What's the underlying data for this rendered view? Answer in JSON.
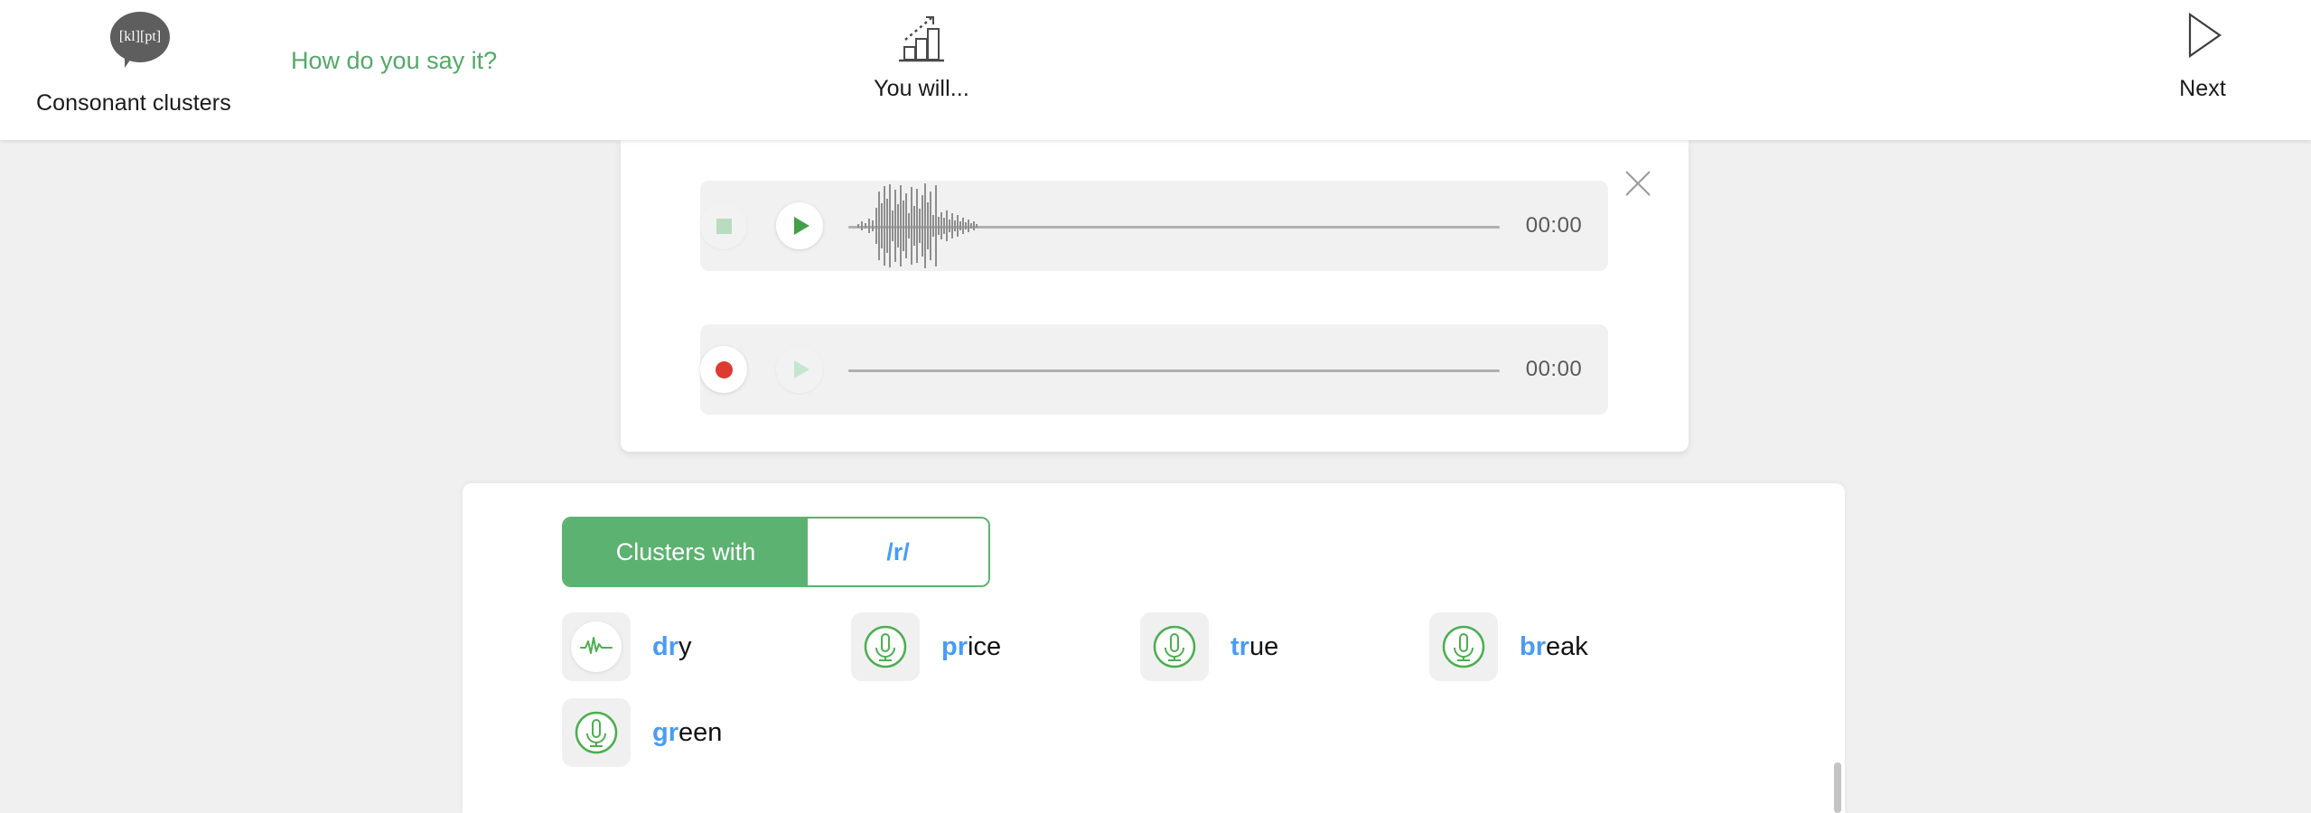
{
  "header": {
    "consonant": {
      "bubble_text": "[kl][pt]",
      "label": "Consonant clusters",
      "icon": "speech-bubble-icon"
    },
    "howto_title": "How do you say it?",
    "youwill": {
      "label": "You will...",
      "icon": "bar-chart-growth-icon"
    },
    "next": {
      "label": "Next",
      "icon": "play-triangle-outline-icon"
    }
  },
  "players": {
    "close_icon": "close-icon",
    "rows": [
      {
        "left_button": "stop-button",
        "play_button": "play-button",
        "play_disabled": false,
        "has_waveform": true,
        "time": "00:00"
      },
      {
        "left_button": "record-button",
        "play_button": "play-button",
        "play_disabled": true,
        "has_waveform": false,
        "time": "00:00"
      }
    ]
  },
  "practice": {
    "tabs": [
      {
        "label": "Clusters with",
        "active": true
      },
      {
        "label": "/r/",
        "active": false
      }
    ],
    "words": [
      {
        "prefix": "dr",
        "rest": "y",
        "icon": "waveform-icon"
      },
      {
        "prefix": "pr",
        "rest": "ice",
        "icon": "microphone-icon"
      },
      {
        "prefix": "tr",
        "rest": "ue",
        "icon": "microphone-icon"
      },
      {
        "prefix": "br",
        "rest": "eak",
        "icon": "microphone-icon"
      },
      {
        "prefix": "gr",
        "rest": "een",
        "icon": "microphone-icon"
      }
    ]
  },
  "colors": {
    "brand_green": "#5cb270",
    "accent_blue": "#4a9bf5",
    "record_red": "#dd3b30",
    "page_bg": "#f0f0f0"
  }
}
